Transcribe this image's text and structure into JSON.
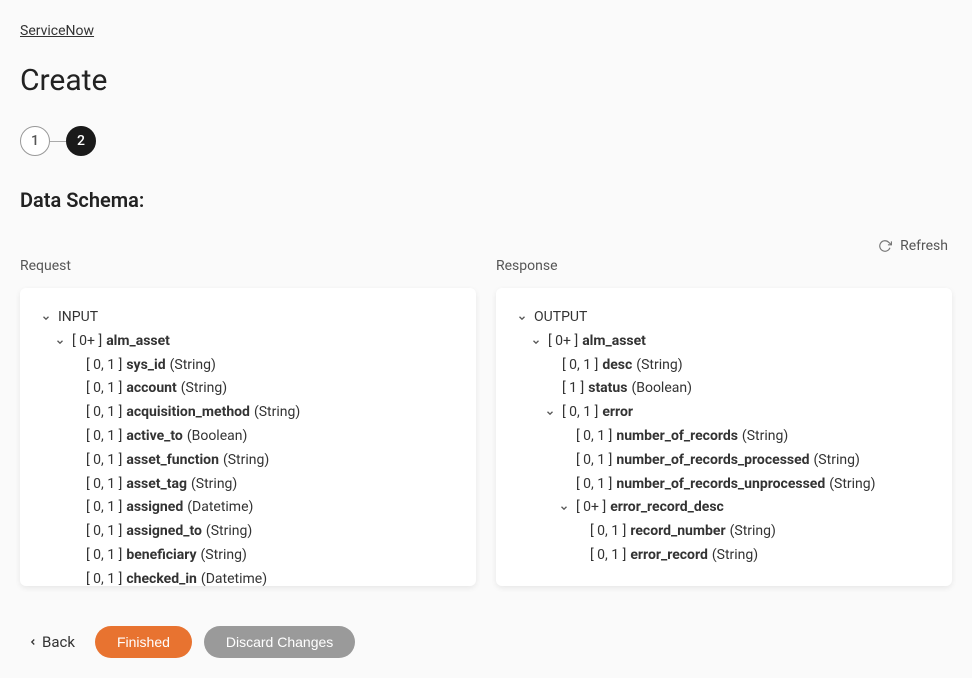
{
  "breadcrumb": {
    "label": "ServiceNow"
  },
  "page": {
    "title": "Create"
  },
  "stepper": {
    "steps": [
      "1",
      "2"
    ],
    "active": 1
  },
  "section": {
    "title": "Data Schema:"
  },
  "refresh": {
    "label": "Refresh"
  },
  "request": {
    "label": "Request",
    "root": "INPUT",
    "tree": [
      {
        "indent": 1,
        "card": "[ 0+ ]",
        "name": "alm_asset",
        "type": "",
        "expand": true
      },
      {
        "indent": 2,
        "card": "[ 0, 1 ]",
        "name": "sys_id",
        "type": "(String)"
      },
      {
        "indent": 2,
        "card": "[ 0, 1 ]",
        "name": "account",
        "type": "(String)"
      },
      {
        "indent": 2,
        "card": "[ 0, 1 ]",
        "name": "acquisition_method",
        "type": "(String)"
      },
      {
        "indent": 2,
        "card": "[ 0, 1 ]",
        "name": "active_to",
        "type": "(Boolean)"
      },
      {
        "indent": 2,
        "card": "[ 0, 1 ]",
        "name": "asset_function",
        "type": "(String)"
      },
      {
        "indent": 2,
        "card": "[ 0, 1 ]",
        "name": "asset_tag",
        "type": "(String)"
      },
      {
        "indent": 2,
        "card": "[ 0, 1 ]",
        "name": "assigned",
        "type": "(Datetime)"
      },
      {
        "indent": 2,
        "card": "[ 0, 1 ]",
        "name": "assigned_to",
        "type": "(String)"
      },
      {
        "indent": 2,
        "card": "[ 0, 1 ]",
        "name": "beneficiary",
        "type": "(String)"
      },
      {
        "indent": 2,
        "card": "[ 0, 1 ]",
        "name": "checked_in",
        "type": "(Datetime)"
      }
    ]
  },
  "response": {
    "label": "Response",
    "root": "OUTPUT",
    "tree": [
      {
        "indent": 1,
        "card": "[ 0+ ]",
        "name": "alm_asset",
        "type": "",
        "expand": true
      },
      {
        "indent": 2,
        "card": "[ 0, 1 ]",
        "name": "desc",
        "type": "(String)"
      },
      {
        "indent": 2,
        "card": "[ 1 ]",
        "name": "status",
        "type": "(Boolean)"
      },
      {
        "indent": 2,
        "card": "[ 0, 1 ]",
        "name": "error",
        "type": "",
        "expand": true
      },
      {
        "indent": 3,
        "card": "[ 0, 1 ]",
        "name": "number_of_records",
        "type": "(String)"
      },
      {
        "indent": 3,
        "card": "[ 0, 1 ]",
        "name": "number_of_records_processed",
        "type": "(String)"
      },
      {
        "indent": 3,
        "card": "[ 0, 1 ]",
        "name": "number_of_records_unprocessed",
        "type": "(String)"
      },
      {
        "indent": 3,
        "card": "[ 0+ ]",
        "name": "error_record_desc",
        "type": "",
        "expand": true
      },
      {
        "indent": 4,
        "card": "[ 0, 1 ]",
        "name": "record_number",
        "type": "(String)"
      },
      {
        "indent": 4,
        "card": "[ 0, 1 ]",
        "name": "error_record",
        "type": "(String)"
      }
    ]
  },
  "footer": {
    "back": "Back",
    "finished": "Finished",
    "discard": "Discard Changes"
  }
}
